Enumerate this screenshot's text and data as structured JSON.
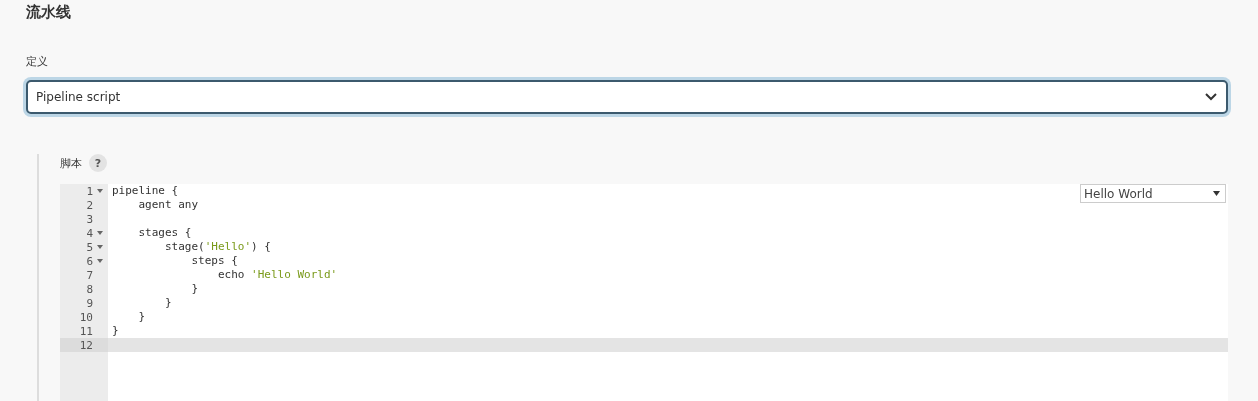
{
  "section_title": "流水线",
  "definition": {
    "label": "定义",
    "value": "Pipeline script"
  },
  "script": {
    "label": "脚本",
    "help": "?",
    "sample_select": "Hello World",
    "lines": [
      {
        "number": "1",
        "foldable": true,
        "active": false,
        "tokens": [
          {
            "kind": "plain",
            "text": "pipeline {"
          }
        ]
      },
      {
        "number": "2",
        "foldable": false,
        "active": false,
        "tokens": [
          {
            "kind": "plain",
            "text": "    agent any"
          }
        ]
      },
      {
        "number": "3",
        "foldable": false,
        "active": false
      },
      {
        "number": "4",
        "foldable": true,
        "active": false,
        "tokens": [
          {
            "kind": "plain",
            "text": "    stages {"
          }
        ]
      },
      {
        "number": "5",
        "foldable": true,
        "active": false,
        "tokens": [
          {
            "kind": "plain",
            "text": "        stage("
          },
          {
            "kind": "string",
            "text": "'Hello'"
          },
          {
            "kind": "plain",
            "text": ") {"
          }
        ]
      },
      {
        "number": "6",
        "foldable": true,
        "active": false,
        "tokens": [
          {
            "kind": "plain",
            "text": "            steps {"
          }
        ]
      },
      {
        "number": "7",
        "foldable": false,
        "active": false,
        "tokens": [
          {
            "kind": "plain",
            "text": "                echo "
          },
          {
            "kind": "string",
            "text": "'Hello World'"
          }
        ]
      },
      {
        "number": "8",
        "foldable": false,
        "active": false,
        "tokens": [
          {
            "kind": "plain",
            "text": "            }"
          }
        ]
      },
      {
        "number": "9",
        "foldable": false,
        "active": false,
        "tokens": [
          {
            "kind": "plain",
            "text": "        }"
          }
        ]
      },
      {
        "number": "10",
        "foldable": false,
        "active": false,
        "tokens": [
          {
            "kind": "plain",
            "text": "    }"
          }
        ]
      },
      {
        "number": "11",
        "foldable": false,
        "active": false,
        "tokens": [
          {
            "kind": "plain",
            "text": "}"
          }
        ]
      },
      {
        "number": "12",
        "foldable": false,
        "active": true
      }
    ]
  }
}
